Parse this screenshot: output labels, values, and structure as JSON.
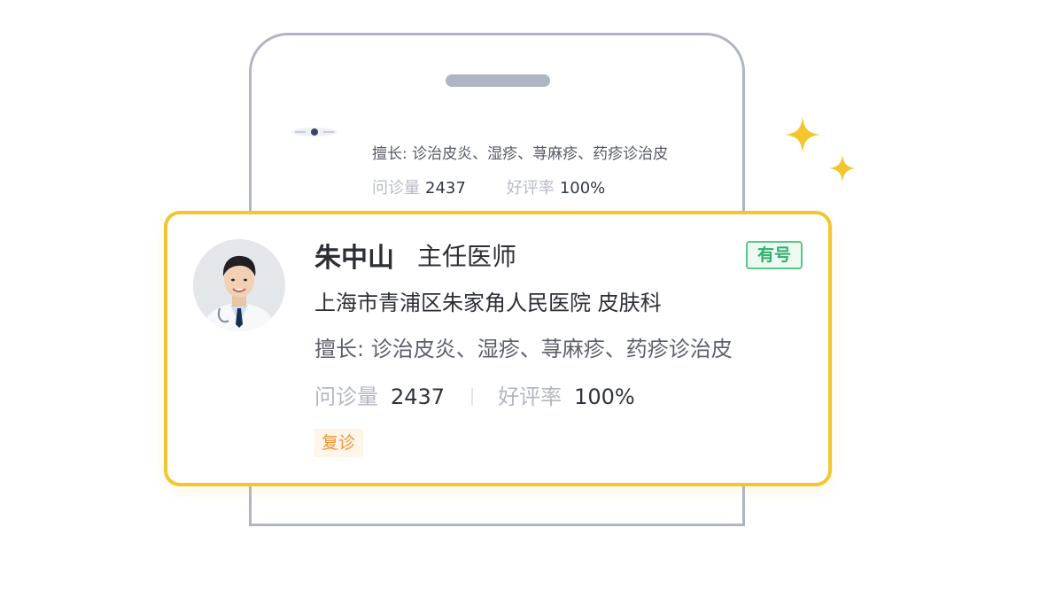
{
  "colors": {
    "phone_outline": "#aeb6c4",
    "card_border": "#f3c531",
    "sparkle": "#f4c52c",
    "badge_green": "#2fae6c",
    "tag_orange": "#f0943a"
  },
  "background_card": {
    "specialty": "擅长: 诊治皮炎、湿疹、荨麻疹、药疹诊治皮",
    "consult_label": "问诊量",
    "consult_value": "2437",
    "rating_label": "好评率",
    "rating_value": "100%"
  },
  "doctor_card": {
    "name": "朱中山",
    "title": "主任医师",
    "availability_badge": "有号",
    "hospital_department": "上海市青浦区朱家角人民医院 皮肤科",
    "specialty": "擅长: 诊治皮炎、湿疹、荨麻疹、药疹诊治皮",
    "consult_label": "问诊量",
    "consult_value": "2437",
    "rating_label": "好评率",
    "rating_value": "100%",
    "tag": "复诊"
  },
  "icons": {
    "sparkle": "sparkle-icon",
    "avatar": "doctor-avatar"
  }
}
